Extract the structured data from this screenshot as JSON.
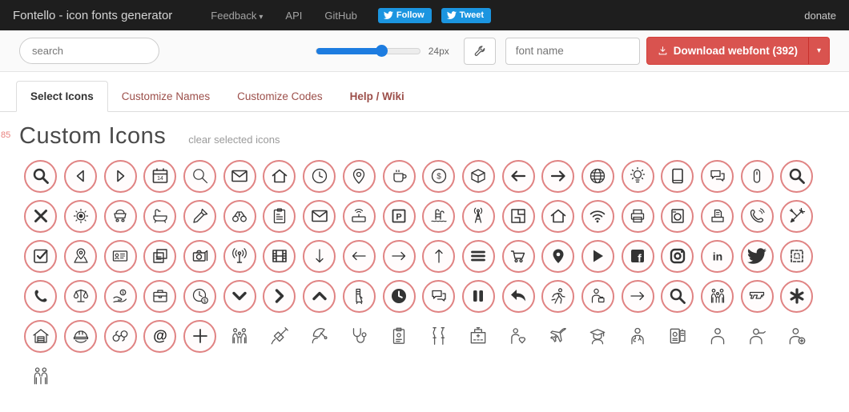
{
  "navbar": {
    "brand": "Fontello - icon fonts generator",
    "links": [
      {
        "label": "Feedback",
        "has_caret": true
      },
      {
        "label": "API"
      },
      {
        "label": "GitHub"
      }
    ],
    "twitter_follow": "Follow",
    "twitter_tweet": "Tweet",
    "donate": "donate"
  },
  "toolbar": {
    "search_placeholder": "search",
    "slider_percent": 64,
    "size_label": "24px",
    "wrench_icon": "wrench-icon",
    "fontname_placeholder": "font name",
    "download_label": "Download webfont (392)",
    "download_caret": "▾"
  },
  "tabs": [
    {
      "label": "Select Icons",
      "active": true
    },
    {
      "label": "Customize Names"
    },
    {
      "label": "Customize Codes"
    },
    {
      "label": "Help / Wiki",
      "bold": true
    }
  ],
  "section": {
    "selected_count": "85",
    "title": "Custom Icons",
    "clear_label": "clear selected icons"
  },
  "colors": {
    "navbar_bg": "#1e1e1e",
    "twitter_blue": "#1b95e0",
    "slider_blue": "#1d7ce0",
    "download_red": "#d9534f",
    "tab_red": "#9c4f4a",
    "circle_red": "#e08383"
  },
  "icons": [
    {
      "name": "search",
      "icon": "search-bold",
      "sel": true
    },
    {
      "name": "triangle-left",
      "icon": "tri-left",
      "sel": true
    },
    {
      "name": "triangle-right",
      "icon": "tri-right",
      "sel": true
    },
    {
      "name": "calendar",
      "icon": "calendar",
      "sel": true
    },
    {
      "name": "search-thin",
      "icon": "search-thin",
      "sel": true
    },
    {
      "name": "mail",
      "icon": "mail",
      "sel": true
    },
    {
      "name": "home",
      "icon": "home",
      "sel": true
    },
    {
      "name": "clock",
      "icon": "clock",
      "sel": true
    },
    {
      "name": "location-pin",
      "icon": "pin",
      "sel": true
    },
    {
      "name": "coffee",
      "icon": "coffee",
      "sel": true
    },
    {
      "name": "dollar-coin",
      "icon": "dollar-coin",
      "sel": true
    },
    {
      "name": "package-box",
      "icon": "package",
      "sel": true
    },
    {
      "name": "arrow-left",
      "icon": "arrow-left",
      "sel": true
    },
    {
      "name": "arrow-right",
      "icon": "arrow-right",
      "sel": true
    },
    {
      "name": "globe",
      "icon": "globe",
      "sel": true
    },
    {
      "name": "lightbulb",
      "icon": "bulb",
      "sel": true
    },
    {
      "name": "tablet",
      "icon": "tablet",
      "sel": true
    },
    {
      "name": "chat-bubbles",
      "icon": "chat",
      "sel": true
    },
    {
      "name": "mouse",
      "icon": "mouse",
      "sel": true
    },
    {
      "name": "search-bold",
      "icon": "search-bold",
      "sel": true
    },
    {
      "name": "close-x",
      "icon": "close",
      "sel": true
    },
    {
      "name": "brightness-sun",
      "icon": "sun",
      "sel": true
    },
    {
      "name": "cart-loaded",
      "icon": "cart-full",
      "sel": true
    },
    {
      "name": "bathtub",
      "icon": "bath",
      "sel": true
    },
    {
      "name": "screwdriver",
      "icon": "screwdriver",
      "sel": true
    },
    {
      "name": "binoculars",
      "icon": "binoculars",
      "sel": true
    },
    {
      "name": "clipboard",
      "icon": "clipboard",
      "sel": true
    },
    {
      "name": "mail-bold",
      "icon": "mail",
      "sel": true
    },
    {
      "name": "wifi-router",
      "icon": "router",
      "sel": true
    },
    {
      "name": "parking-sign",
      "icon": "parking",
      "sel": true
    },
    {
      "name": "pool-ladder",
      "icon": "pool",
      "sel": true
    },
    {
      "name": "radio-tower",
      "icon": "tower",
      "sel": true
    },
    {
      "name": "floor-plan",
      "icon": "floorplan",
      "sel": true
    },
    {
      "name": "home-small",
      "icon": "home",
      "sel": true
    },
    {
      "name": "wifi",
      "icon": "wifi",
      "sel": true
    },
    {
      "name": "printer",
      "icon": "printer",
      "sel": true
    },
    {
      "name": "washing-machine",
      "icon": "washer",
      "sel": true
    },
    {
      "name": "print-document",
      "icon": "printdoc",
      "sel": true
    },
    {
      "name": "phone-ringing",
      "icon": "phone-ring",
      "sel": true
    },
    {
      "name": "tools-crossed",
      "icon": "tools",
      "sel": true
    },
    {
      "name": "checkbox-checked",
      "icon": "check-box",
      "sel": true
    },
    {
      "name": "map-location-pin",
      "icon": "map-pin",
      "sel": true
    },
    {
      "name": "id-card",
      "icon": "idcard",
      "sel": true
    },
    {
      "name": "copy-pages",
      "icon": "layers",
      "sel": true
    },
    {
      "name": "camera-photos",
      "icon": "camera",
      "sel": true
    },
    {
      "name": "broadcast-antenna",
      "icon": "antenna",
      "sel": true
    },
    {
      "name": "film-strip",
      "icon": "film",
      "sel": true
    },
    {
      "name": "arrow-down-thin",
      "icon": "arrow-down-thin",
      "sel": true
    },
    {
      "name": "arrow-left-thin",
      "icon": "arrow-left-thin",
      "sel": true
    },
    {
      "name": "arrow-right-thin",
      "icon": "arrow-right-thin",
      "sel": true
    },
    {
      "name": "arrow-up-thin",
      "icon": "arrow-up-thin",
      "sel": true
    },
    {
      "name": "menu-hamburger",
      "icon": "menu",
      "sel": true
    },
    {
      "name": "shopping-cart",
      "icon": "cart-empty",
      "sel": true
    },
    {
      "name": "location-pin-solid",
      "icon": "pin-solid",
      "sel": true
    },
    {
      "name": "play",
      "icon": "play",
      "sel": true
    },
    {
      "name": "facebook",
      "icon": "facebook",
      "sel": true
    },
    {
      "name": "instagram",
      "icon": "instagram",
      "sel": true
    },
    {
      "name": "linkedin",
      "icon": "linkedin",
      "sel": true
    },
    {
      "name": "twitter",
      "icon": "twitter",
      "sel": true
    },
    {
      "name": "puzzle-pattern",
      "icon": "puzzle",
      "sel": true
    },
    {
      "name": "phone-solid",
      "icon": "phone-solid",
      "sel": true
    },
    {
      "name": "scales-balance",
      "icon": "scales",
      "sel": true
    },
    {
      "name": "hand-coin",
      "icon": "hand-coin",
      "sel": true
    },
    {
      "name": "briefcase",
      "icon": "briefcase",
      "sel": true
    },
    {
      "name": "clock-dollar",
      "icon": "clock-dollar",
      "sel": true
    },
    {
      "name": "chevron-down",
      "icon": "chev-down",
      "sel": true
    },
    {
      "name": "chevron-right",
      "icon": "chev-right",
      "sel": true
    },
    {
      "name": "chevron-up",
      "icon": "chev-up",
      "sel": true
    },
    {
      "name": "leg-cast",
      "icon": "leg-cast",
      "sel": true
    },
    {
      "name": "clock-solid",
      "icon": "clock-solid",
      "sel": true
    },
    {
      "name": "chat-bubbles",
      "icon": "chat",
      "sel": true
    },
    {
      "name": "pause",
      "icon": "pause",
      "sel": true
    },
    {
      "name": "reply-arrow",
      "icon": "reply",
      "sel": true
    },
    {
      "name": "runner-tools",
      "icon": "runner",
      "sel": true
    },
    {
      "name": "worker-briefcase",
      "icon": "worker",
      "sel": true
    },
    {
      "name": "arrow-right-thin",
      "icon": "arrow-right-thin",
      "sel": true
    },
    {
      "name": "search-bold",
      "icon": "search-bold",
      "sel": true
    },
    {
      "name": "family-group",
      "icon": "family3",
      "sel": true
    },
    {
      "name": "pistol",
      "icon": "pistol",
      "sel": true
    },
    {
      "name": "asterisk",
      "icon": "asterisk",
      "sel": true
    },
    {
      "name": "house-garage",
      "icon": "house-garage",
      "sel": true
    },
    {
      "name": "hard-hat",
      "icon": "hardhat",
      "sel": true
    },
    {
      "name": "handcuffs",
      "icon": "handcuffs",
      "sel": true
    },
    {
      "name": "at-sign",
      "icon": "at-solid",
      "sel": true
    },
    {
      "name": "plus",
      "icon": "plus",
      "sel": true
    },
    {
      "name": "family-group",
      "icon": "family3",
      "sel": false
    },
    {
      "name": "syringe",
      "icon": "syringe",
      "sel": false
    },
    {
      "name": "satellite-dish",
      "icon": "satellite",
      "sel": false
    },
    {
      "name": "stethoscope",
      "icon": "stethoscope",
      "sel": false
    },
    {
      "name": "clipboard-badge",
      "icon": "clip-badge",
      "sel": false
    },
    {
      "name": "crutches",
      "icon": "crutches",
      "sel": false
    },
    {
      "name": "hospital-building",
      "icon": "hospital",
      "sel": false
    },
    {
      "name": "person-care-heart",
      "icon": "person-heart",
      "sel": false
    },
    {
      "name": "airplane",
      "icon": "airplane",
      "sel": false
    },
    {
      "name": "graduate",
      "icon": "graduate",
      "sel": false
    },
    {
      "name": "doctor",
      "icon": "doctor",
      "sel": false
    },
    {
      "name": "passport-documents",
      "icon": "passport",
      "sel": false
    },
    {
      "name": "person",
      "icon": "person",
      "sel": false
    },
    {
      "name": "person-headset",
      "icon": "person-headset",
      "sel": false
    },
    {
      "name": "nurse-plus",
      "icon": "nurse-plus",
      "sel": false
    },
    {
      "name": "family-child",
      "icon": "family2",
      "sel": false
    }
  ]
}
